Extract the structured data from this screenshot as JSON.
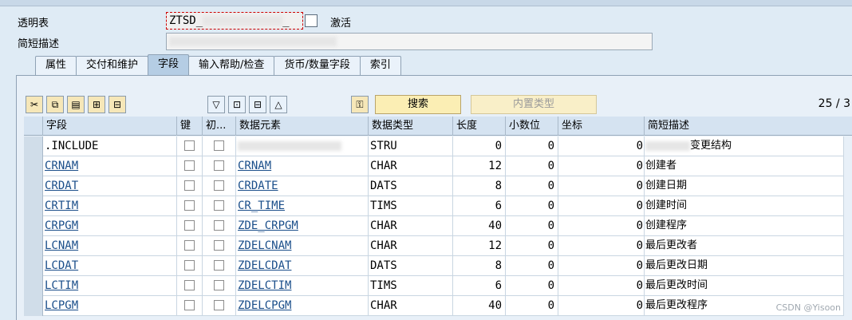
{
  "header": {
    "table_label": "透明表",
    "table_name_prefix": "ZTSD_",
    "table_name_mid": "_",
    "status": "激活",
    "desc_label": "简短描述"
  },
  "tabs": [
    "属性",
    "交付和维护",
    "字段",
    "输入帮助/检查",
    "货币/数量字段",
    "索引"
  ],
  "active_tab": 2,
  "toolbar": {
    "search_label": "搜索",
    "builtin_label": "内置类型",
    "counter": "25 / 3"
  },
  "columns": [
    "字段",
    "键",
    "初...",
    "数据元素",
    "数据类型",
    "长度",
    "小数位",
    "坐标",
    "简短描述"
  ],
  "rows": [
    {
      "field": ".INCLUDE",
      "element": "",
      "type": "STRU",
      "length": "0",
      "decimals": "0",
      "coord": "0",
      "desc": "变更结构"
    },
    {
      "field": "CRNAM",
      "element": "CRNAM",
      "type": "CHAR",
      "length": "12",
      "decimals": "0",
      "coord": "0",
      "desc": "创建者"
    },
    {
      "field": "CRDAT",
      "element": "CRDATE",
      "type": "DATS",
      "length": "8",
      "decimals": "0",
      "coord": "0",
      "desc": "创建日期"
    },
    {
      "field": "CRTIM",
      "element": "CR_TIME",
      "type": "TIMS",
      "length": "6",
      "decimals": "0",
      "coord": "0",
      "desc": "创建时间"
    },
    {
      "field": "CRPGM",
      "element": "ZDE_CRPGM",
      "type": "CHAR",
      "length": "40",
      "decimals": "0",
      "coord": "0",
      "desc": "创建程序"
    },
    {
      "field": "LCNAM",
      "element": "ZDELCNAM",
      "type": "CHAR",
      "length": "12",
      "decimals": "0",
      "coord": "0",
      "desc": "最后更改者"
    },
    {
      "field": "LCDAT",
      "element": "ZDELCDAT",
      "type": "DATS",
      "length": "8",
      "decimals": "0",
      "coord": "0",
      "desc": "最后更改日期"
    },
    {
      "field": "LCTIM",
      "element": "ZDELCTIM",
      "type": "TIMS",
      "length": "6",
      "decimals": "0",
      "coord": "0",
      "desc": "最后更改时间"
    },
    {
      "field": "LCPGM",
      "element": "ZDELCPGM",
      "type": "CHAR",
      "length": "40",
      "decimals": "0",
      "coord": "0",
      "desc": "最后更改程序"
    }
  ],
  "watermark": "CSDN @Yisoon"
}
